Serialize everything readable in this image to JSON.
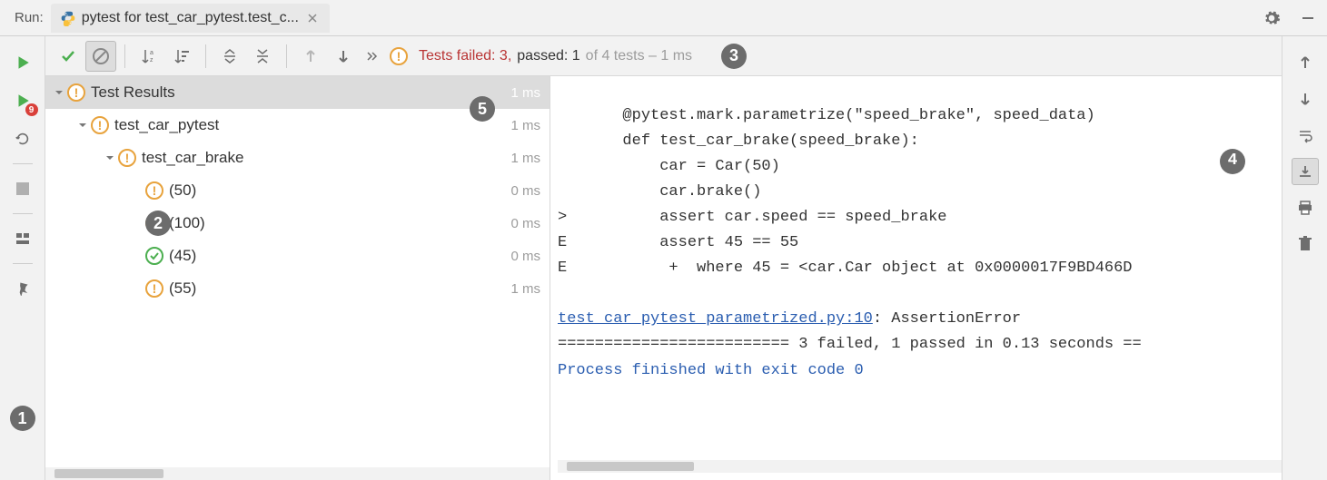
{
  "header": {
    "run_label": "Run:",
    "tab_title": "pytest for test_car_pytest.test_c..."
  },
  "status": {
    "failed_label": "Tests failed: 3,",
    "passed_label": "passed: 1",
    "total_label": "of 4 tests – 1 ms"
  },
  "tree": {
    "root": {
      "label": "Test Results",
      "time": "1 ms"
    },
    "file": {
      "label": "test_car_pytest",
      "time": "1 ms"
    },
    "func": {
      "label": "test_car_brake",
      "time": "1 ms"
    },
    "params": [
      {
        "label": "(50)",
        "time": "0 ms",
        "status": "warn"
      },
      {
        "label": "(100)",
        "time": "0 ms",
        "status": "warn"
      },
      {
        "label": "(45)",
        "time": "0 ms",
        "status": "ok"
      },
      {
        "label": "(55)",
        "time": "1 ms",
        "status": "warn"
      }
    ]
  },
  "console": {
    "l0": "       @pytest.mark.parametrize(\"speed_brake\", speed_data)",
    "l1": "       def test_car_brake(speed_brake):",
    "l2": "           car = Car(50)",
    "l3": "           car.brake()",
    "l4": ">          assert car.speed == speed_brake",
    "l5": "E          assert 45 == 55",
    "l6": "E           +  where 45 = <car.Car object at 0x0000017F9BD466D",
    "l7": "",
    "link": "test_car_pytest_parametrized.py:10",
    "link_suffix": ": AssertionError",
    "summary": "========================= 3 failed, 1 passed in 0.13 seconds ==",
    "exit": "Process finished with exit code 0"
  },
  "callouts": {
    "c1": "1",
    "c2": "2",
    "c3": "3",
    "c4": "4",
    "c5": "5"
  }
}
